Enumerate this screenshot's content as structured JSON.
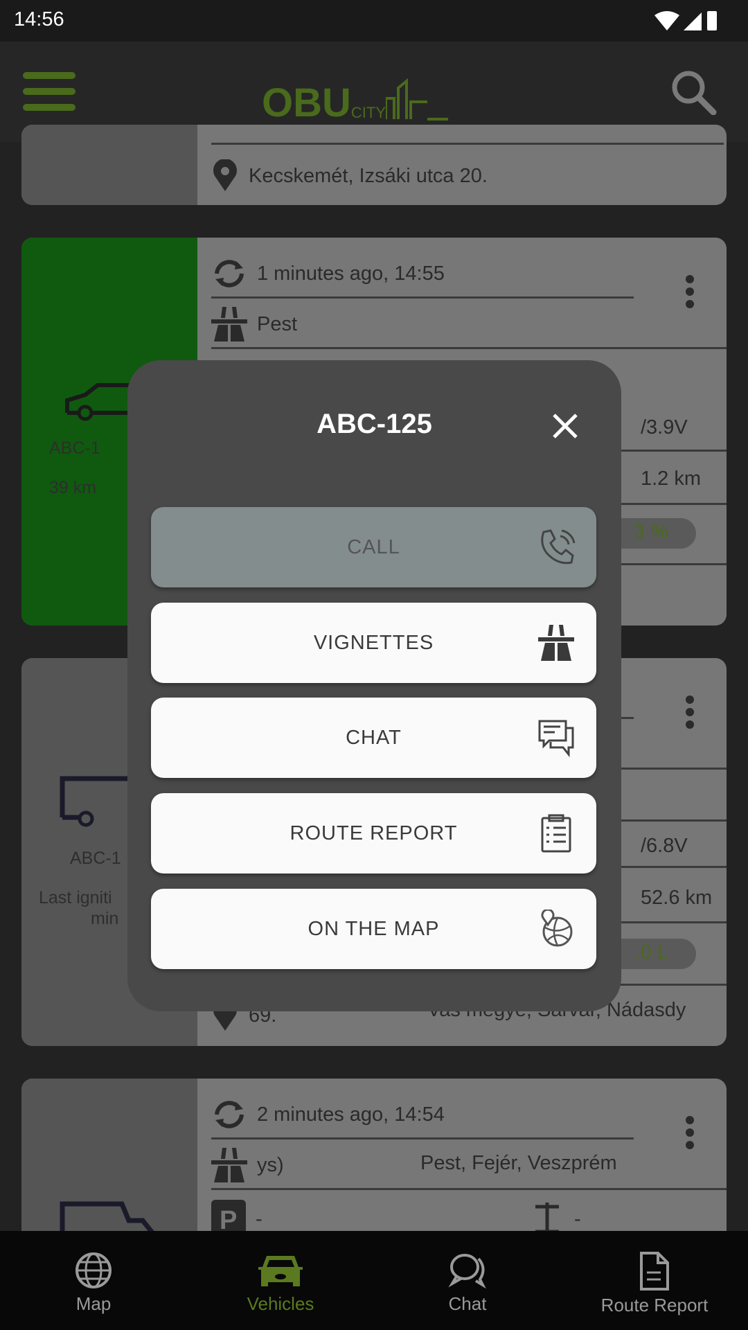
{
  "status_bar": {
    "time": "14:56"
  },
  "header": {
    "logo_text": "OBU",
    "logo_sub": "CITY",
    "menu_icon": "hamburger-icon",
    "search_icon": "search-icon"
  },
  "cards": [
    {
      "address": "Kecskemét, Izsáki utca 20."
    },
    {
      "plate": "ABC-1",
      "distance": "39 km",
      "updated": "1 minutes ago, 14:55",
      "vignette": "Pest",
      "voltage": "/3.9V",
      "odometer": "1.2 km",
      "fuel": "3 %",
      "status_color": "#0f5a0f"
    },
    {
      "plate": "ABC-1",
      "ignition_line1": "Last igniti",
      "ignition_line2": "min",
      "voltage": "/6.8V",
      "odometer": "52.6 km",
      "fuel": ".0 L",
      "address_num": "69.",
      "address": "Vas megye, Sárvár, Nádasdy"
    },
    {
      "updated": "2 minutes ago, 14:54",
      "vignette_left": "ys)",
      "vignette_right": "Pest, Fejér, Veszprém",
      "parking": "-",
      "axle": "-"
    }
  ],
  "dialog": {
    "title": "ABC-125",
    "buttons": [
      {
        "label": "CALL",
        "icon": "phone-icon",
        "enabled": false
      },
      {
        "label": "VIGNETTES",
        "icon": "highway-icon",
        "enabled": true
      },
      {
        "label": "CHAT",
        "icon": "chat-icon",
        "enabled": true
      },
      {
        "label": "ROUTE REPORT",
        "icon": "clipboard-icon",
        "enabled": true
      },
      {
        "label": "ON THE MAP",
        "icon": "globe-pin-icon",
        "enabled": true
      }
    ]
  },
  "bottom_nav": {
    "items": [
      {
        "label": "Map",
        "icon": "globe-icon"
      },
      {
        "label": "Vehicles",
        "icon": "car-icon",
        "active": true
      },
      {
        "label": "Chat",
        "icon": "chat-bubbles-icon"
      },
      {
        "label": "Route Report",
        "icon": "document-icon"
      }
    ],
    "active_color": "#5b7a1f"
  }
}
